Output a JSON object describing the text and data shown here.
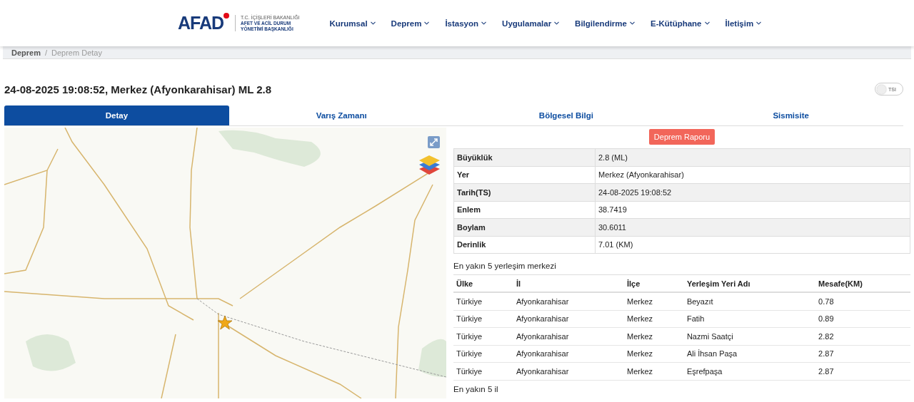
{
  "header": {
    "logo": {
      "text": "AFAD",
      "ministry": "T.C. İÇİŞLERİ BAKANLIĞI",
      "agency": [
        "AFET VE ACİL DURUM",
        "YÖNETİMİ BAŞKANLIĞI"
      ]
    },
    "nav": [
      "Kurumsal",
      "Deprem",
      "İstasyon",
      "Uygulamalar",
      "Bilgilendirme",
      "E-Kütüphane",
      "İletişim"
    ]
  },
  "breadcrumb": [
    "Deprem",
    "Deprem Detay"
  ],
  "breadcrumb_separator": "/",
  "title": "24-08-2025 19:08:52, Merkez (Afyonkarahisar) ML 2.8",
  "toggle": {
    "label": "TSI",
    "on": false
  },
  "tabs": [
    {
      "label": "Detay",
      "selected": true
    },
    {
      "label": "Varış Zamanı",
      "selected": false
    },
    {
      "label": "Bölgesel Bilgi",
      "selected": false
    },
    {
      "label": "Sismisite",
      "selected": false
    }
  ],
  "report_button": "Deprem Raporu",
  "details": [
    {
      "label": "Büyüklük",
      "value": "2.8 (ML)"
    },
    {
      "label": "Yer",
      "value": "Merkez (Afyonkarahisar)"
    },
    {
      "label": "Tarih(TS)",
      "value": "24-08-2025 19:08:52"
    },
    {
      "label": "Enlem",
      "value": "38.7419"
    },
    {
      "label": "Boylam",
      "value": "30.6011"
    },
    {
      "label": "Derinlik",
      "value": "7.01 (KM)"
    }
  ],
  "settlements": {
    "title": "En yakın 5 yerleşim merkezi",
    "columns": [
      "Ülke",
      "İl",
      "İlçe",
      "Yerleşim Yeri Adı",
      "Mesafe(KM)"
    ],
    "rows": [
      [
        "Türkiye",
        "Afyonkarahisar",
        "Merkez",
        "Beyazıt",
        "0.78"
      ],
      [
        "Türkiye",
        "Afyonkarahisar",
        "Merkez",
        "Fatih",
        "0.89"
      ],
      [
        "Türkiye",
        "Afyonkarahisar",
        "Merkez",
        "Nazmi Saatçi",
        "2.82"
      ],
      [
        "Türkiye",
        "Afyonkarahisar",
        "Merkez",
        "Ali İhsan Paşa",
        "2.87"
      ],
      [
        "Türkiye",
        "Afyonkarahisar",
        "Merkez",
        "Eşrefpaşa",
        "2.87"
      ]
    ]
  },
  "provinces_title": "En yakın 5 il"
}
